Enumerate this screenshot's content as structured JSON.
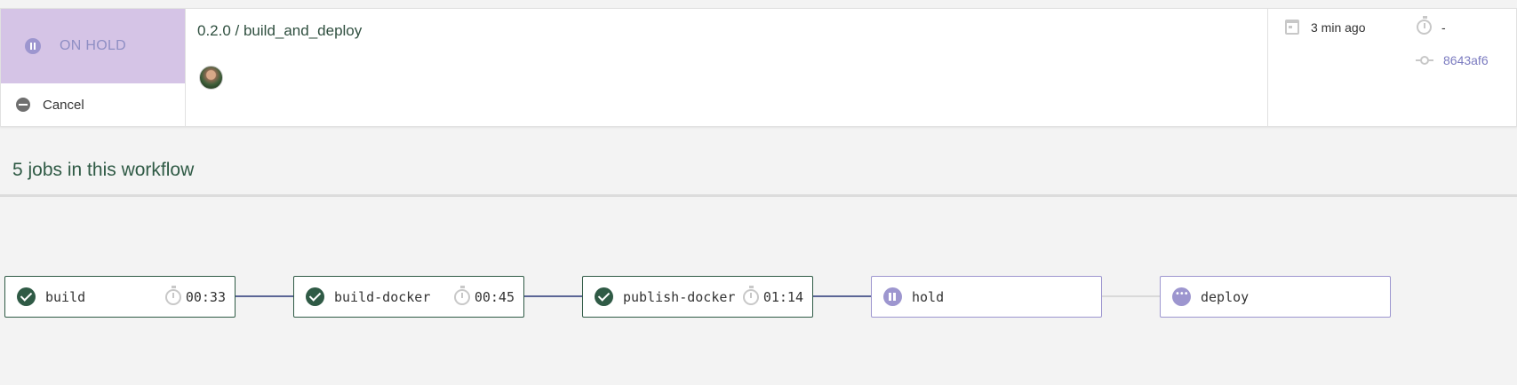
{
  "status": {
    "label": "ON HOLD",
    "icon": "pause-icon",
    "color": "#d5c4e6"
  },
  "actions": {
    "cancel_label": "Cancel"
  },
  "workflow": {
    "title": "0.2.0 / build_and_deploy"
  },
  "meta": {
    "time_ago": "3 min ago",
    "duration": "-",
    "commit_sha": "8643af6"
  },
  "section": {
    "title": "5 jobs in this workflow"
  },
  "colors": {
    "success": "#2f5a45",
    "hold": "#9d96cf",
    "connector_done": "#5b6596",
    "connector_pending": "#d9d9d9"
  },
  "jobs": [
    {
      "name": "build",
      "status": "success",
      "status_icon": "check-circle-icon",
      "duration": "00:33"
    },
    {
      "name": "build-docker",
      "status": "success",
      "status_icon": "check-circle-icon",
      "duration": "00:45"
    },
    {
      "name": "publish-docker",
      "status": "success",
      "status_icon": "check-circle-icon",
      "duration": "01:14"
    },
    {
      "name": "hold",
      "status": "on_hold",
      "status_icon": "pause-icon",
      "duration": ""
    },
    {
      "name": "deploy",
      "status": "queued",
      "status_icon": "more-dots-icon",
      "duration": ""
    }
  ]
}
